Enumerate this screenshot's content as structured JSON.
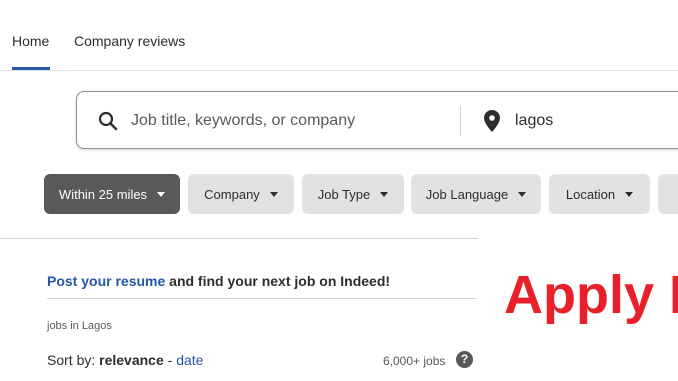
{
  "nav": {
    "home_label": "Home",
    "reviews_label": "Company reviews"
  },
  "search": {
    "what_placeholder": "Job title, keywords, or company",
    "where_value": "lagos"
  },
  "filters": [
    {
      "label": "Within 25 miles",
      "active": true
    },
    {
      "label": "Company"
    },
    {
      "label": "Job Type"
    },
    {
      "label": "Job Language"
    },
    {
      "label": "Location"
    }
  ],
  "resume": {
    "link_text": "Post your resume",
    "rest_text": " and find your next job on Indeed!"
  },
  "results": {
    "jobs_in": "jobs in Lagos",
    "sort_prefix": "Sort by: ",
    "sort_relevance": "relevance",
    "sort_sep": " - ",
    "sort_date": "date",
    "count": "6,000+ jobs",
    "help_glyph": "?"
  },
  "banner": {
    "text": "Apply N"
  },
  "colors": {
    "accent": "#2557a7",
    "banner": "#e8202a",
    "chip_active": "#595959",
    "chip": "#e4e2e0"
  }
}
